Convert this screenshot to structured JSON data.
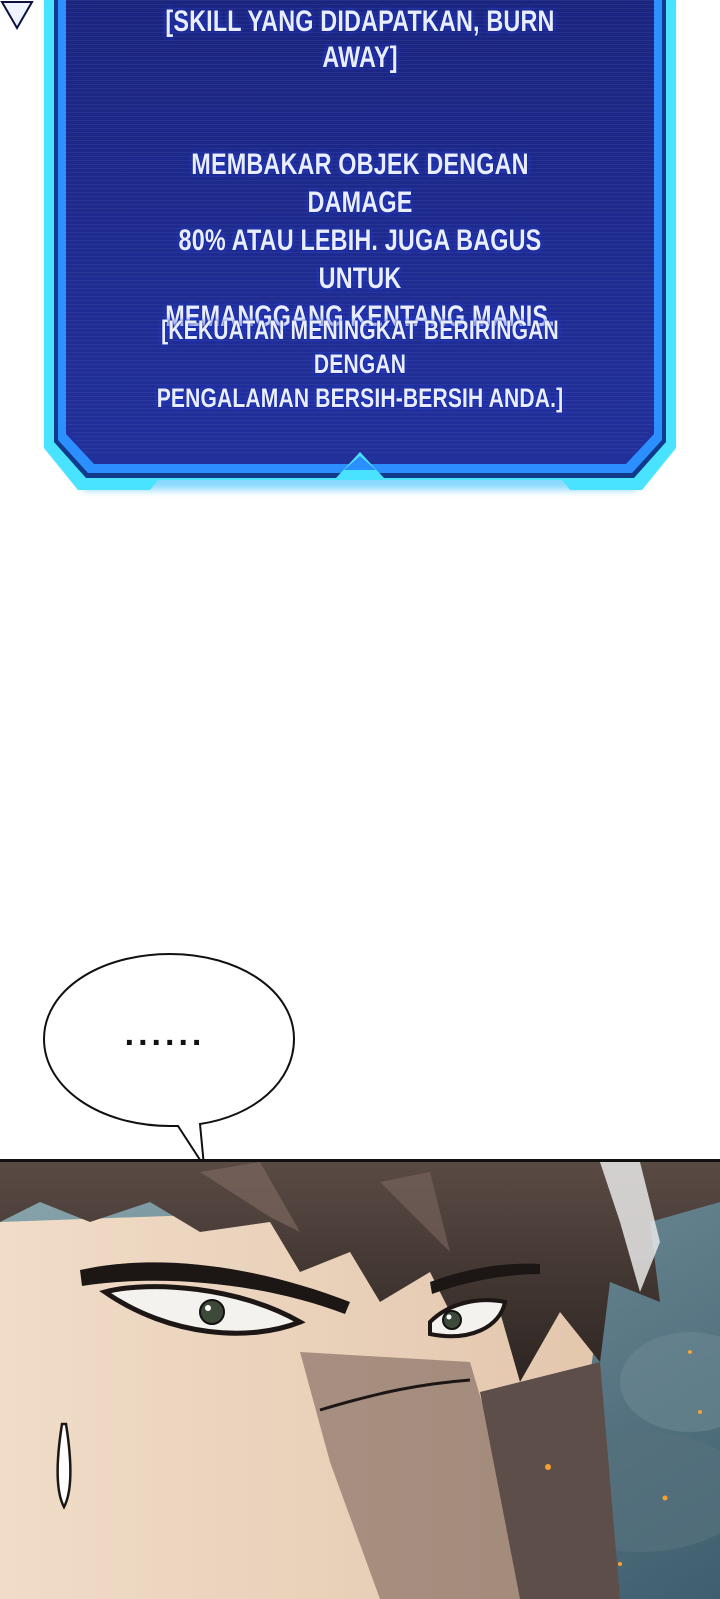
{
  "system_window": {
    "title": "[SKILL YANG DIDAPATKAN, BURN AWAY]",
    "description_lines": [
      "MEMBAKAR OBJEK DENGAN DAMAGE",
      "80% ATAU LEBIH. JUGA BAGUS UNTUK",
      "MEMANGGANG KENTANG MANIS."
    ],
    "note_lines": [
      "[KEKUATAN MENINGKAT BERIRINGAN DENGAN",
      "PENGALAMAN BERSIH-BERSIH ANDA.]"
    ],
    "colors": {
      "panel_bg": "#1b2a8c",
      "border": "#3fe6ff",
      "text": "#e8eeff"
    }
  },
  "speech_bubble": {
    "text": "......"
  },
  "panel": {
    "description": "close-up of character face with sweat drop"
  }
}
